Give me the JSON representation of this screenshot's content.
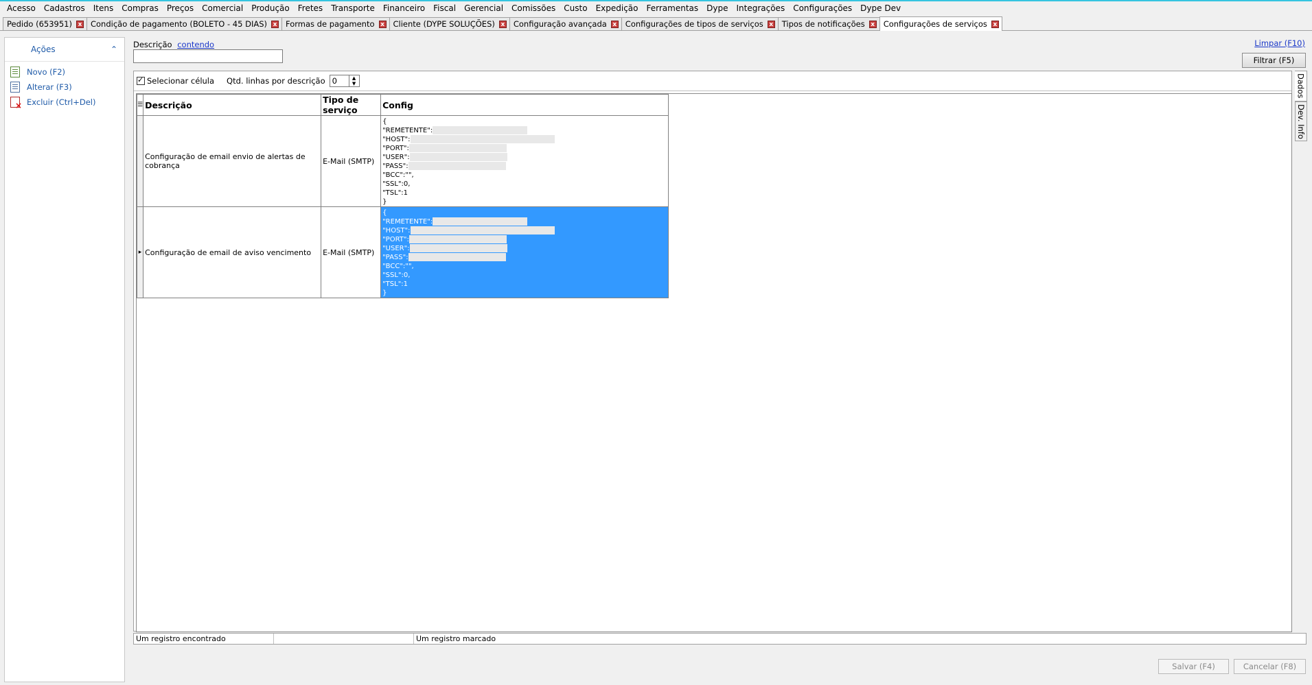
{
  "menu": [
    "Acesso",
    "Cadastros",
    "Itens",
    "Compras",
    "Preços",
    "Comercial",
    "Produção",
    "Fretes",
    "Transporte",
    "Financeiro",
    "Fiscal",
    "Gerencial",
    "Comissões",
    "Custo",
    "Expedição",
    "Ferramentas",
    "Dype",
    "Integrações",
    "Configurações",
    "Dype Dev"
  ],
  "tabs": [
    {
      "label": "Pedido (653951)"
    },
    {
      "label": "Condição de pagamento (BOLETO  - 45 DIAS)"
    },
    {
      "label": "Formas de pagamento"
    },
    {
      "label": "Cliente (DYPE SOLUÇÕES)"
    },
    {
      "label": "Configuração avançada"
    },
    {
      "label": "Configurações de tipos de serviços"
    },
    {
      "label": "Tipos de notificações"
    },
    {
      "label": "Configurações de serviços"
    }
  ],
  "close_glyph": "x",
  "sidebar": {
    "title": "Ações",
    "collapse_glyph": "⌃",
    "actions": [
      {
        "label": "Novo (F2)",
        "icon": "new-document-icon"
      },
      {
        "label": "Alterar (F3)",
        "icon": "edit-document-icon"
      },
      {
        "label": "Excluir (Ctrl+Del)",
        "icon": "delete-document-icon"
      }
    ]
  },
  "filter": {
    "description_label": "Descrição",
    "mode_link": "contendo",
    "description_value": "",
    "clear_link": "Limpar (F10)",
    "filter_button": "Filtrar (F5)"
  },
  "grid_options": {
    "select_cell_label": "Selecionar célula",
    "select_cell_checked": true,
    "lines_label": "Qtd. linhas por descrição",
    "lines_value": "0"
  },
  "grid": {
    "columns": [
      "Descrição",
      "Tipo de serviço",
      "Config"
    ],
    "rows": [
      {
        "indicator": "",
        "descricao": "Configuração de email envio de alertas de cobrança",
        "tipo": "E-Mail (SMTP)",
        "config": [
          "{",
          "\"REMETENTE\":",
          "\"HOST\":",
          "\"PORT\":",
          "\"USER\":",
          "\"PASS\":",
          "\"BCC\":\"\",",
          "\"SSL\":0,",
          "\"TSL\":1",
          "}"
        ],
        "selected": false
      },
      {
        "indicator": "▸",
        "descricao": "Configuração de email de aviso vencimento",
        "tipo": "E-Mail (SMTP)",
        "config": [
          "{",
          "\"REMETENTE\":",
          "\"HOST\":",
          "\"PORT\":",
          "\"USER\":",
          "\"PASS\":",
          "\"BCC\":\"\",",
          "\"SSL\":0,",
          "\"TSL\":1",
          "}"
        ],
        "selected": true
      }
    ]
  },
  "side_tabs": [
    "Dados",
    "Dev. Info"
  ],
  "status": {
    "records": "Um registro encontrado",
    "middle": "",
    "marked": "Um registro marcado"
  },
  "buttons": {
    "save": "Salvar (F4)",
    "cancel": "Cancelar (F8)"
  },
  "colors": {
    "selection": "#3399ff",
    "link": "#1a37c8",
    "tab_close": "#c9413f"
  }
}
